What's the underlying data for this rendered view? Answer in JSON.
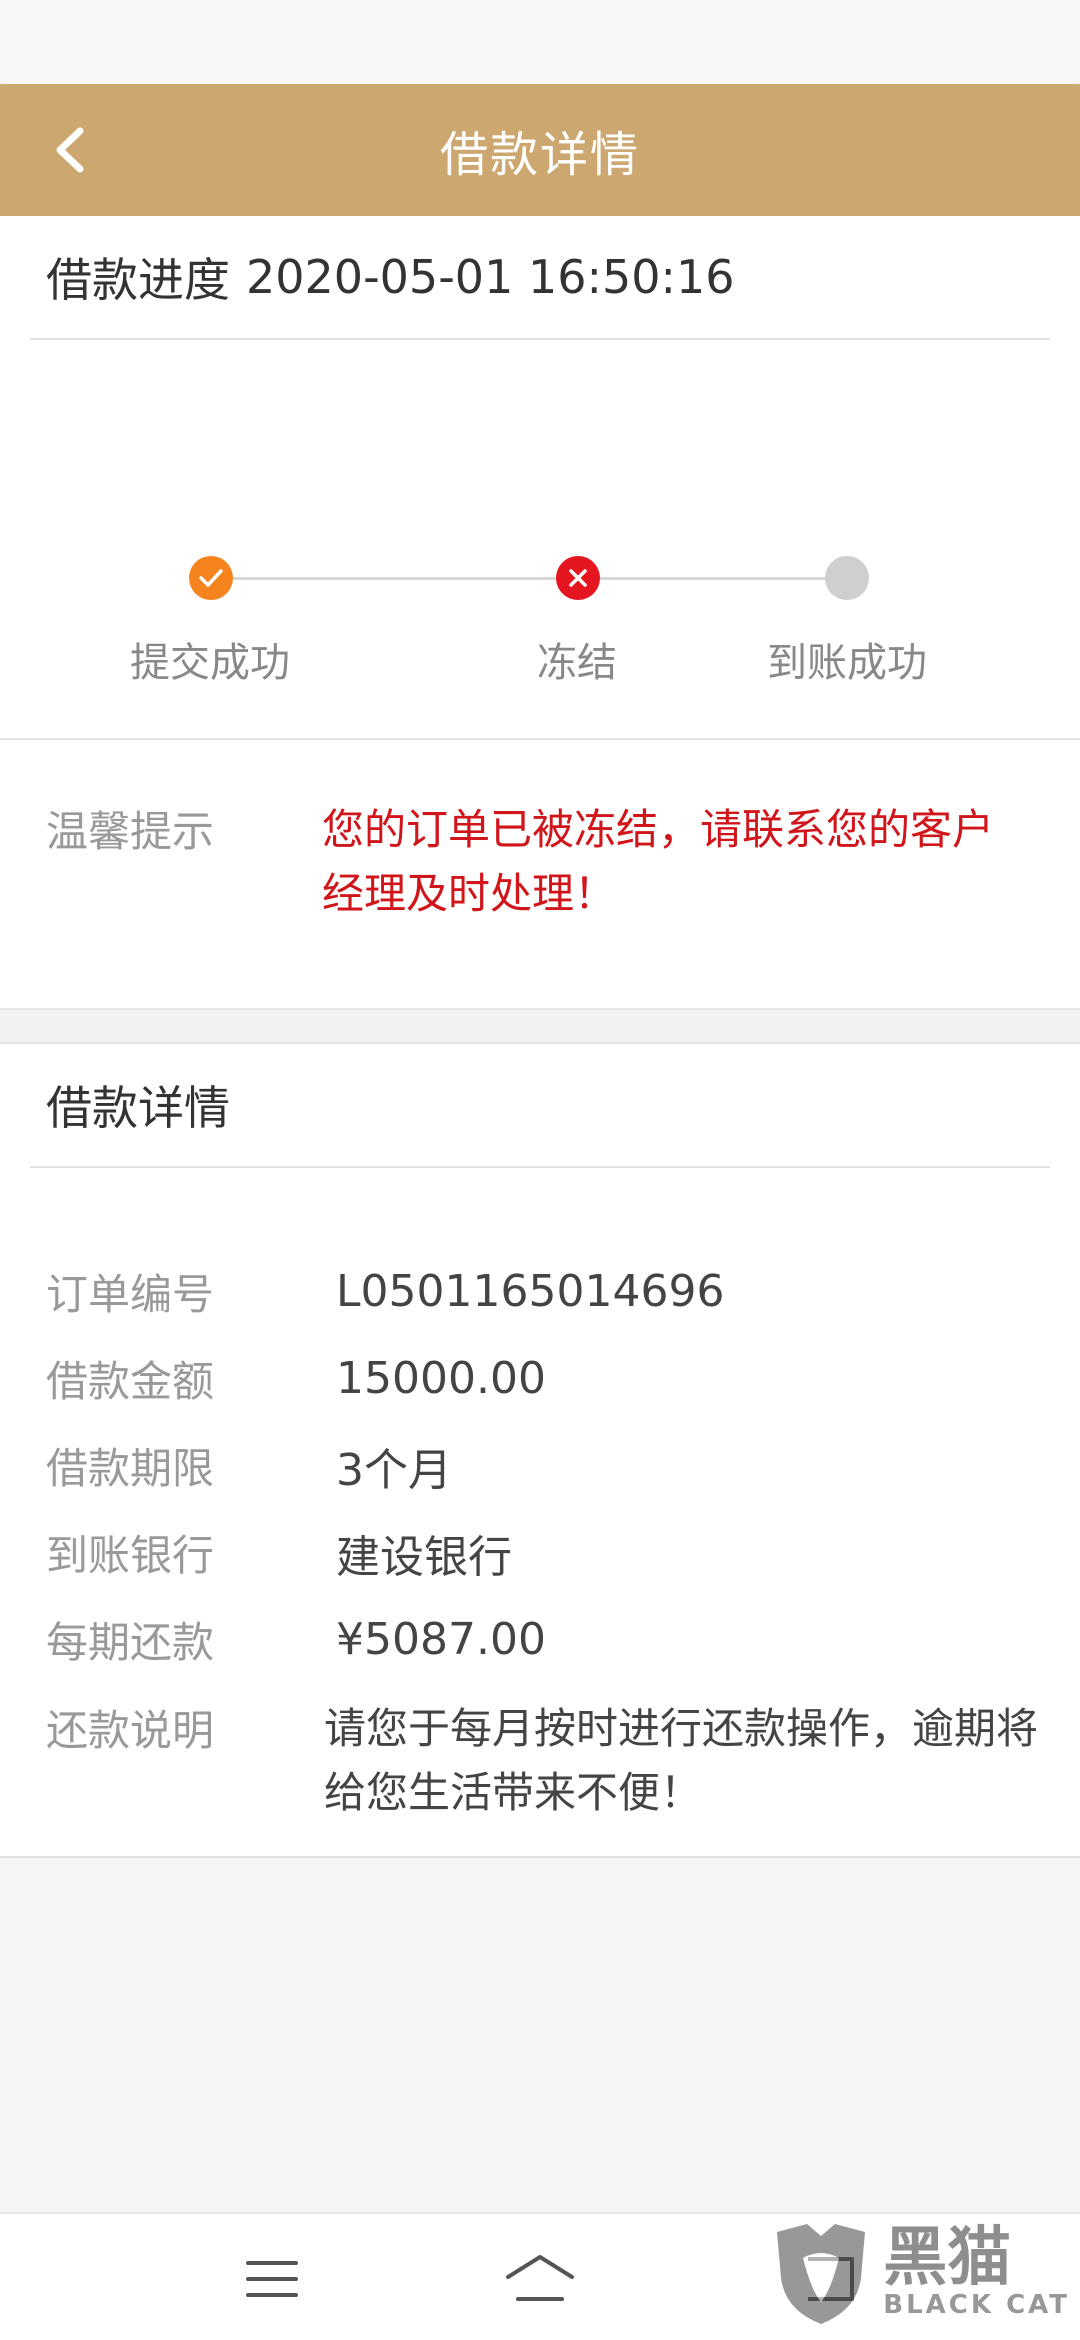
{
  "header": {
    "title": "借款详情",
    "back_icon": "chevron-left-icon",
    "background": "#cca870"
  },
  "progress": {
    "label": "借款进度",
    "time": "2020-05-01 16:50:16",
    "steps": [
      {
        "label": "提交成功",
        "state": "done",
        "color": "#f5841f",
        "icon": "check-icon"
      },
      {
        "label": "冻结",
        "state": "error",
        "color": "#e5161f",
        "icon": "close-icon"
      },
      {
        "label": "到账成功",
        "state": "pending",
        "color": "#cfcfcf",
        "icon": "dot-icon"
      }
    ]
  },
  "tip": {
    "label": "温馨提示",
    "text": "您的订单已被冻结，请联系您的客户经理及时处理！",
    "color": "#d0151b"
  },
  "detail": {
    "title": "借款详情",
    "rows": [
      {
        "key": "订单编号",
        "value": "L0501165014696"
      },
      {
        "key": "借款金额",
        "value": "15000.00"
      },
      {
        "key": "借款期限",
        "value": "3个月"
      },
      {
        "key": "到账银行",
        "value": "建设银行"
      },
      {
        "key": "每期还款",
        "value": "¥5087.00"
      }
    ],
    "note": {
      "key": "还款说明",
      "value": "请您于每月按时进行还款操作，逾期将给您生活带来不便！"
    }
  },
  "bottom_nav": {
    "items": [
      "menu-icon",
      "home-icon",
      "back-icon"
    ]
  },
  "watermark": {
    "cn": "黑猫",
    "en": "BLACK CAT"
  }
}
